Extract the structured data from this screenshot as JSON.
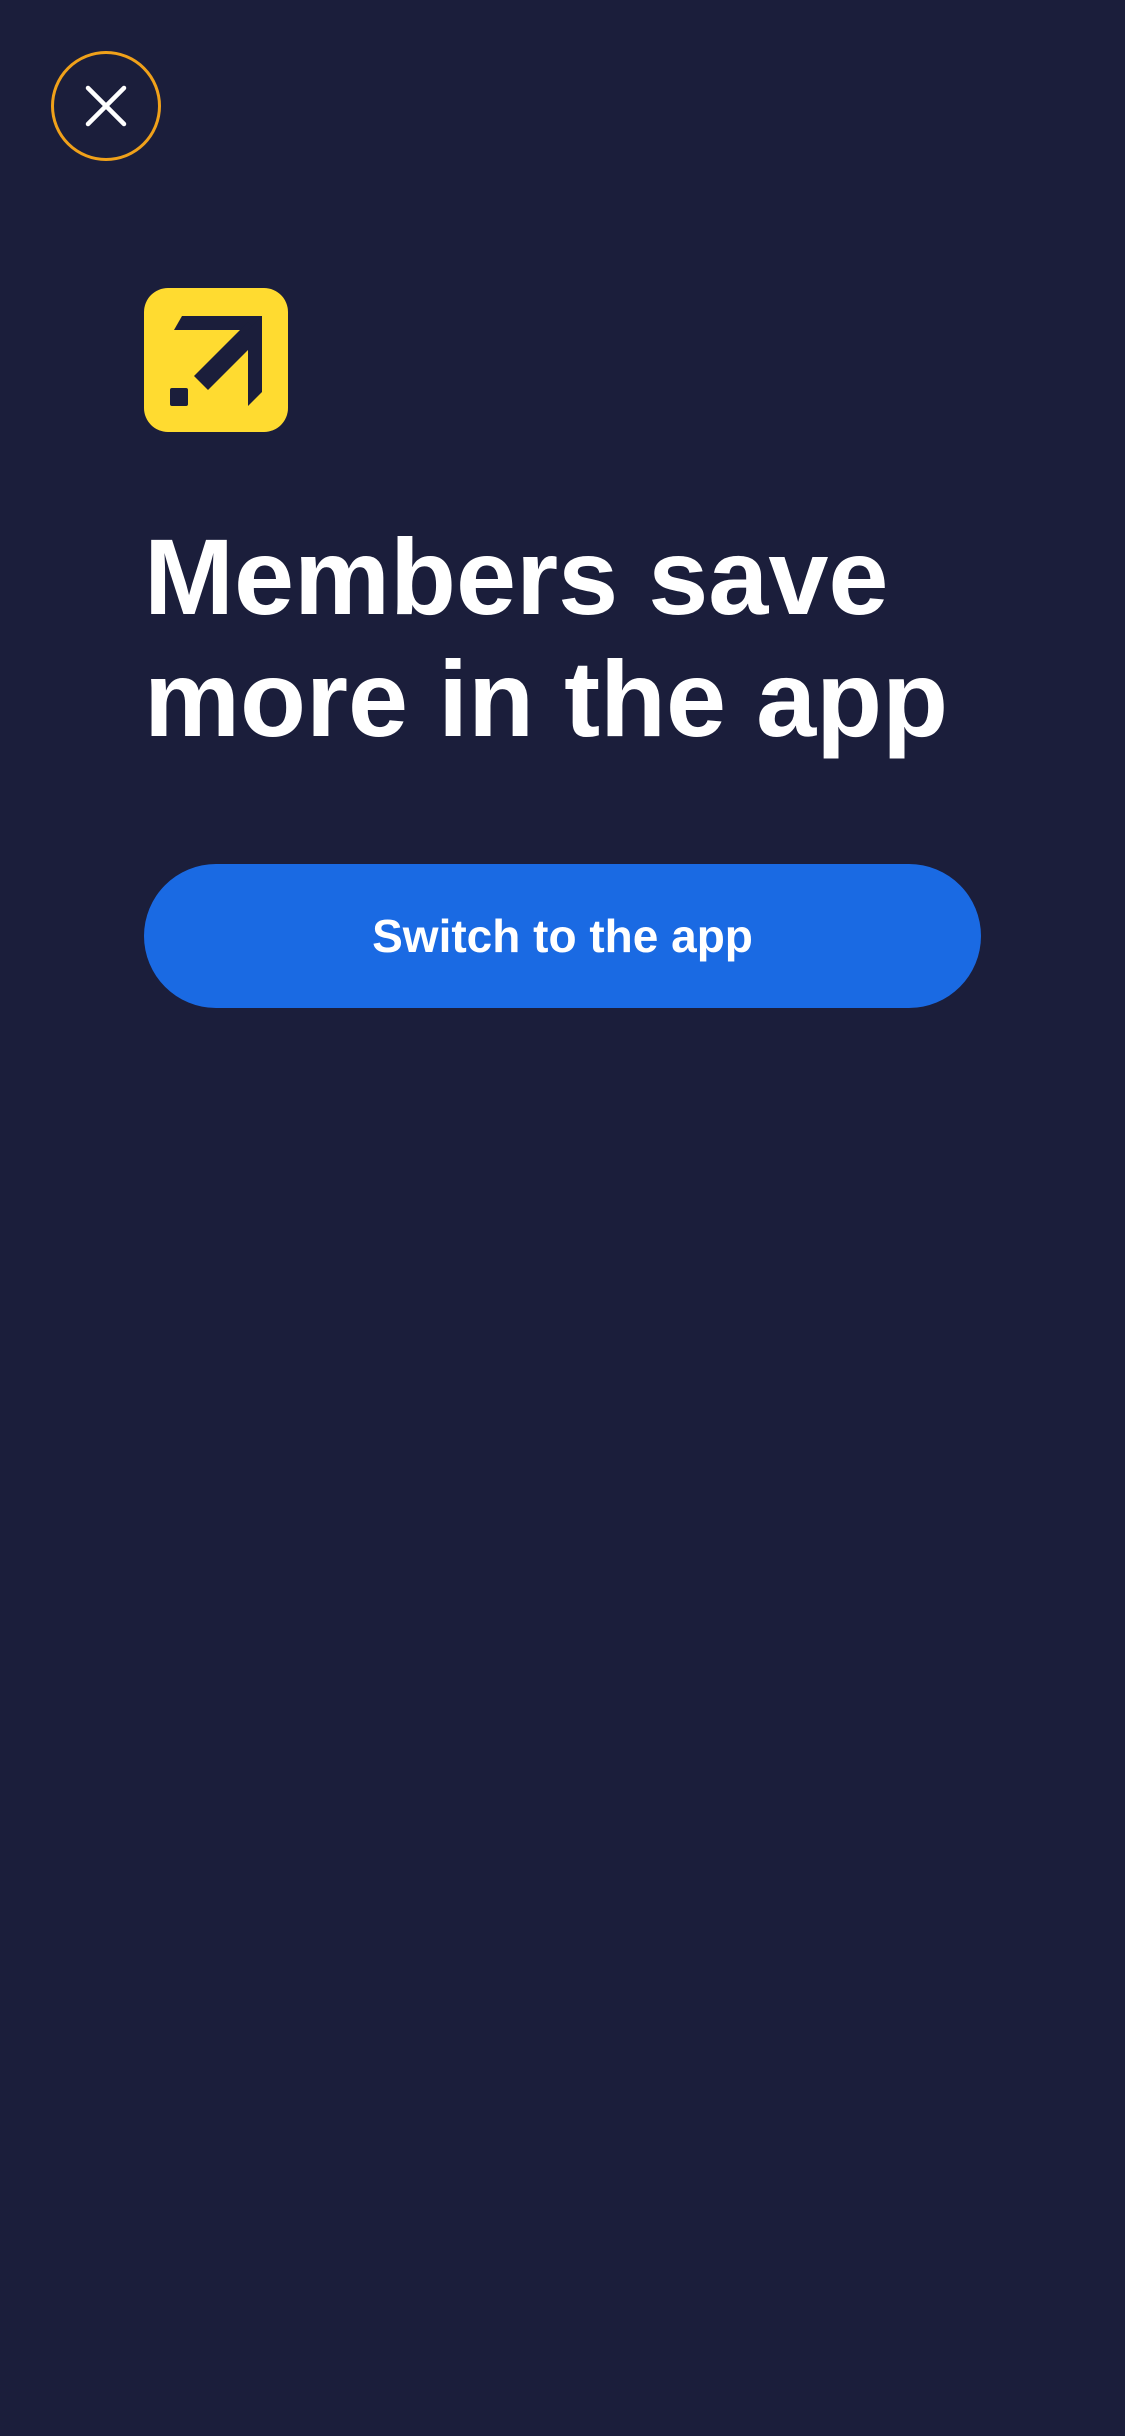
{
  "close_control": {
    "icon": "close-icon",
    "border_color": "#f0a11a"
  },
  "brand": {
    "logo_icon": "expedia-arrow-logo-icon",
    "logo_color": "#ffdb30"
  },
  "headline": {
    "line1": "Members save",
    "line2": "more in the app"
  },
  "cta": {
    "label": "Switch to the app",
    "color": "#1a6ae3"
  },
  "theme": {
    "background": "#1b1e3b",
    "text": "#ffffff"
  }
}
